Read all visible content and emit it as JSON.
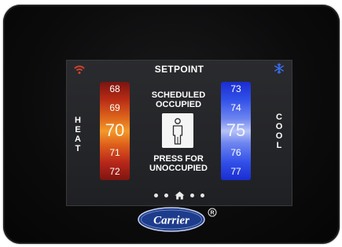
{
  "screen": {
    "title": "SETPOINT",
    "heat_label": [
      "H",
      "E",
      "A",
      "T"
    ],
    "cool_label": [
      "C",
      "O",
      "O",
      "L"
    ],
    "heat_values": [
      "68",
      "69",
      "70",
      "71",
      "72"
    ],
    "cool_values": [
      "73",
      "74",
      "75",
      "76",
      "77"
    ],
    "heat_setpoint": "70",
    "cool_setpoint": "75",
    "status_line1": "SCHEDULED",
    "status_line2": "OCCUPIED",
    "action_line1": "PRESS FOR",
    "action_line2": "UNOCCUPIED",
    "page_indicator": {
      "pages": 5,
      "current": 3,
      "current_icon": "home-icon"
    },
    "icons": {
      "top_left": "wifi-icon",
      "top_right": "snowflake-icon",
      "center": "person-icon"
    }
  },
  "brand": {
    "name": "Carrier",
    "registered": "R"
  },
  "colors": {
    "heat_accent": "#e06a1c",
    "cool_accent": "#3150e8",
    "wifi": "#d9442a",
    "snowflake": "#3a6df0",
    "logo_blue": "#1e3c8c"
  }
}
